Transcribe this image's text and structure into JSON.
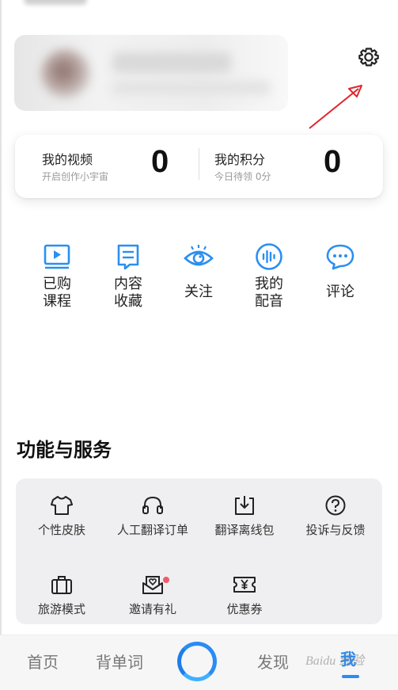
{
  "stats": [
    {
      "title": "我的视频",
      "sub": "开启创作小宇宙",
      "value": "0"
    },
    {
      "title": "我的积分",
      "sub": "今日待领 0分",
      "value": "0"
    }
  ],
  "quick_actions": [
    {
      "line1": "已购",
      "line2": "课程",
      "icon": "play-video-icon"
    },
    {
      "line1": "内容",
      "line2": "收藏",
      "icon": "bookmark-icon"
    },
    {
      "line1": "关注",
      "line2": "",
      "icon": "eye-icon"
    },
    {
      "line1": "我的",
      "line2": "配音",
      "icon": "voice-wave-icon"
    },
    {
      "line1": "评论",
      "line2": "",
      "icon": "chat-bubble-icon"
    }
  ],
  "services": {
    "title": "功能与服务",
    "items": [
      {
        "label": "个性皮肤",
        "icon": "tshirt-icon"
      },
      {
        "label": "人工翻译订单",
        "icon": "headset-icon"
      },
      {
        "label": "翻译离线包",
        "icon": "download-icon"
      },
      {
        "label": "投诉与反馈",
        "icon": "question-circle-icon"
      },
      {
        "label": "旅游模式",
        "icon": "suitcase-icon"
      },
      {
        "label": "邀请有礼",
        "icon": "envelope-heart-icon"
      },
      {
        "label": "优惠券",
        "icon": "coupon-yen-icon"
      }
    ]
  },
  "tabbar": {
    "home": "首页",
    "words": "背单词",
    "discover": "发现",
    "me": "我"
  },
  "watermark": "Baidu 经验",
  "colors": {
    "accent": "#2a8cf5",
    "icon_blue": "#2b8ff0",
    "annotation_red": "#e0262c",
    "badge_dot": "#f25a6b"
  }
}
